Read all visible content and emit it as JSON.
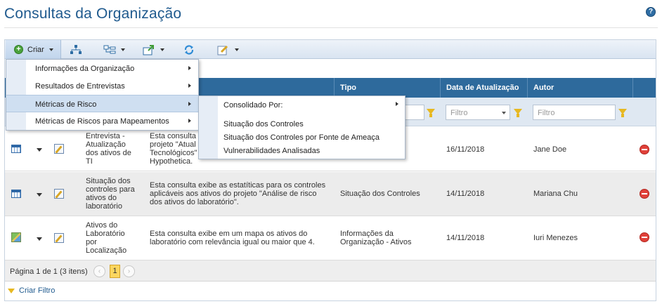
{
  "page": {
    "title": "Consultas da Organização",
    "help_icon": "question-icon"
  },
  "toolbar": {
    "create_label": "Criar",
    "icons": [
      "hierarchy-icon",
      "tree-view-icon",
      "export-icon",
      "refresh-icon",
      "edit-icon"
    ]
  },
  "table": {
    "columns": [
      "Tipo",
      "Data de Atualização",
      "Autor"
    ],
    "filters": {
      "tipo_placeholder": "Filtro",
      "data_placeholder": "Filtro",
      "autor_placeholder": "Filtro"
    },
    "rows": [
      {
        "icon": "table-icon",
        "name": "Entrevista - Atualização dos ativos de TI",
        "description": "Esta consulta ... projeto \"Atual... Tecnológicos\"... Hypothetica.",
        "desc_l1": "Esta consulta",
        "desc_l2": "projeto \"Atual",
        "desc_l3": "Tecnológicos\"",
        "desc_l4": "Hypothetica.",
        "name_l1": "Entrevista -",
        "name_l2": "Atualização",
        "name_l3": "dos ativos de",
        "name_l4": "TI",
        "tipo": "",
        "date": "16/11/2018",
        "author": "Jane Doe"
      },
      {
        "icon": "table-icon",
        "name_l1": "Situação dos",
        "name_l2": "controles para",
        "name_l3": "ativos do",
        "name_l4": "laboratório",
        "desc_l1": "Esta consulta exibe as estatíticas para os controles",
        "desc_l2": "aplicáveis aos ativos do projeto \"Análise de risco",
        "desc_l3": "dos ativos do laboratório\".",
        "tipo_l1": "Situação dos Controles",
        "tipo_l2": "",
        "date": "14/11/2018",
        "author": "Mariana Chu"
      },
      {
        "icon": "map-icon",
        "name_l1": "Ativos do",
        "name_l2": "Laboratório",
        "name_l3": "por",
        "name_l4": "Localização",
        "desc_l1": "Esta consulta exibe em um mapa os ativos do",
        "desc_l2": "laboratório com relevância igual ou maior que 4.",
        "tipo_l1": "Informações da",
        "tipo_l2": "Organização - Ativos",
        "date": "14/11/2018",
        "author": "Iuri Menezes"
      }
    ]
  },
  "pager": {
    "summary": "Página 1 de 1 (3 itens)",
    "prev": "‹",
    "next": "›",
    "current": "1"
  },
  "create_filter_label": "Criar Filtro",
  "menu": {
    "items": [
      "Informações da Organização",
      "Resultados de Entrevistas",
      "Métricas de Risco",
      "Métricas de Riscos para Mapeamentos"
    ],
    "active_index": 2,
    "submenu": [
      "Consolidado Por:",
      "Situação dos Controles",
      "Situação dos Controles por Fonte de Ameaça",
      "Vulnerabilidades Analisadas"
    ]
  },
  "colors": {
    "title": "#1f5a8e",
    "header": "#2e6a9c",
    "filter_row": "#dfe8f2",
    "pager_active": "#fbd65f"
  }
}
